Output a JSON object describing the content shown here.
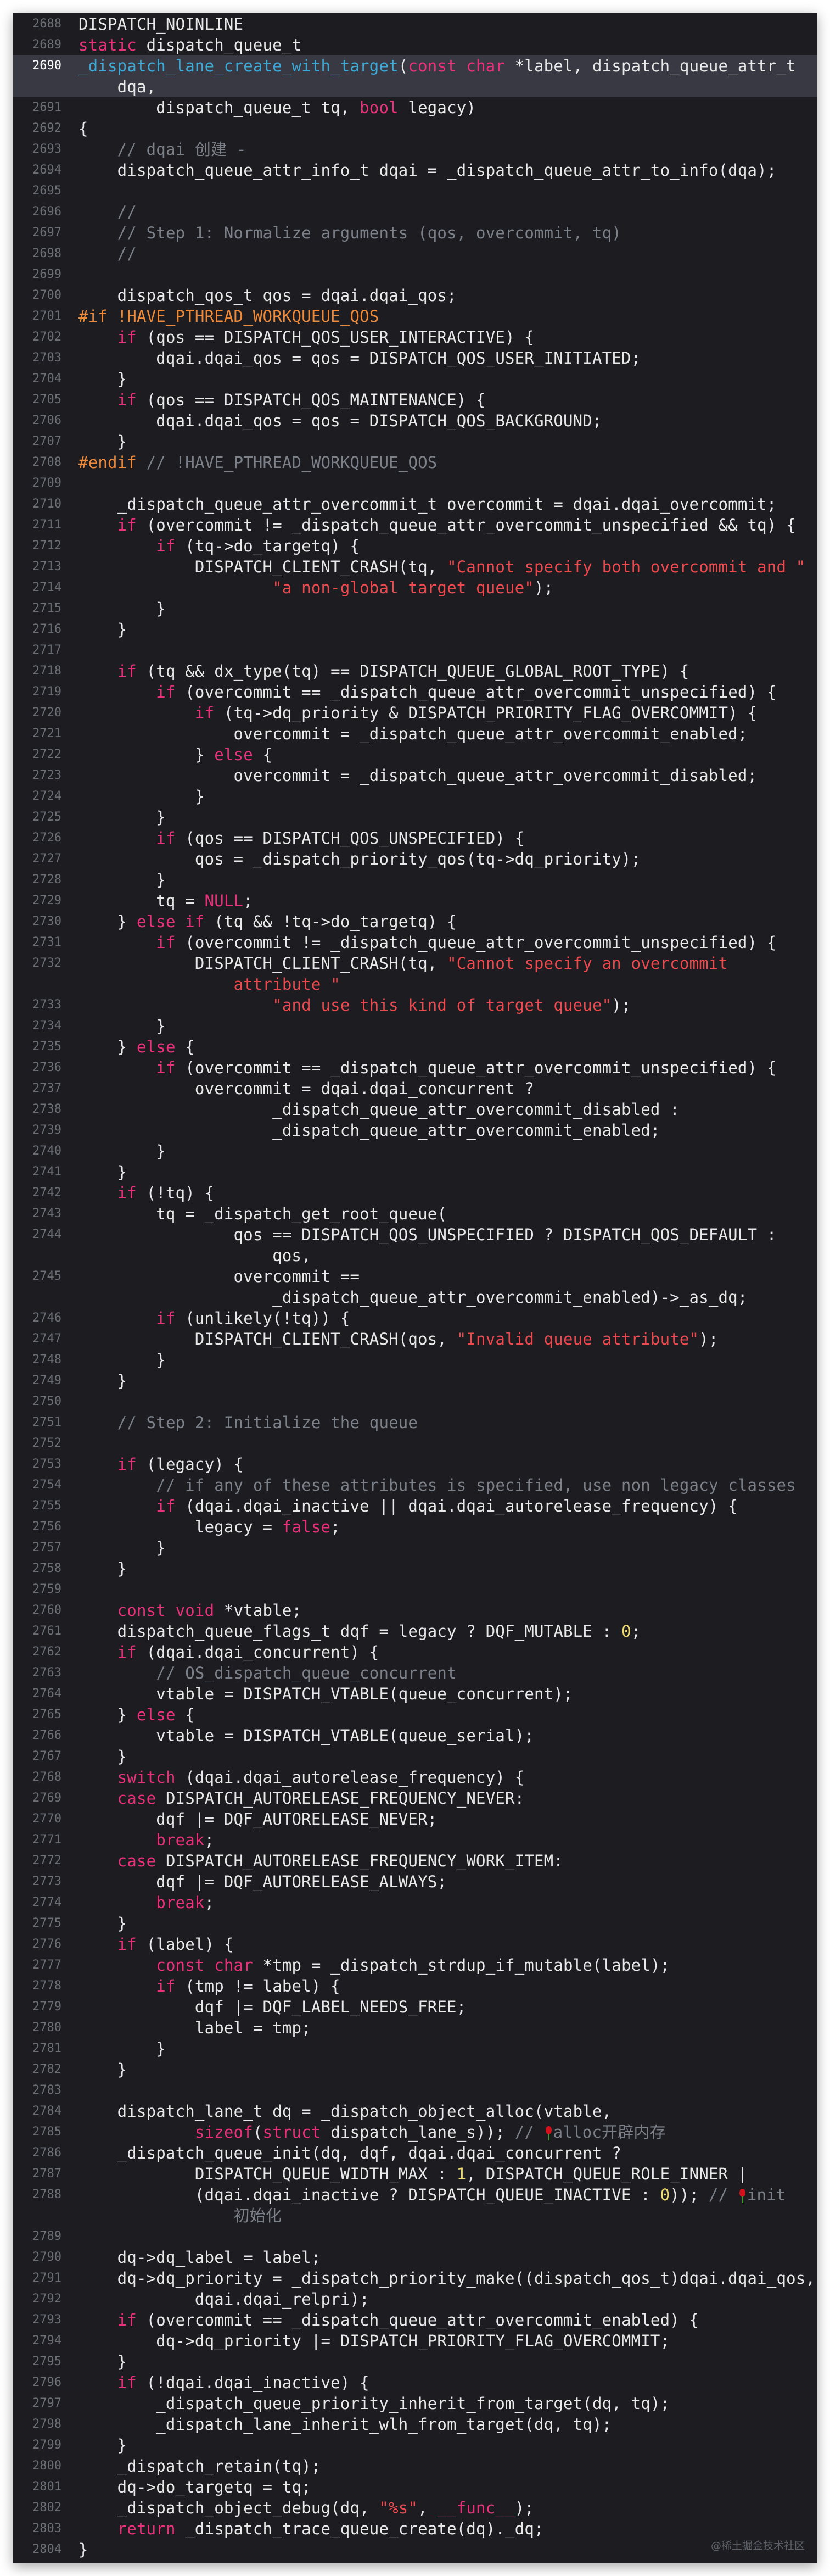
{
  "current_line": 2690,
  "watermark": "@稀土掘金技术社区",
  "colors": {
    "background": "#1c1c21",
    "highlight": "#393944",
    "keyword": "#e8317a",
    "function": "#3fa9d6",
    "string": "#ec4a4f",
    "preprocessor": "#ee8a39",
    "comment": "#7c8089",
    "number": "#eedd6e"
  },
  "lines": [
    {
      "n": 2688,
      "rows": [
        "DISPATCH_NOINLINE"
      ]
    },
    {
      "n": 2689,
      "rows": [
        "⟦k:static⟧ dispatch_queue_t"
      ]
    },
    {
      "n": 2690,
      "rows": [
        "⟦f:_dispatch_lane_create_with_target⟧(⟦k:const char⟧ *label, dispatch_queue_attr_t",
        "    dqa,"
      ]
    },
    {
      "n": 2691,
      "rows": [
        "        dispatch_queue_t tq, ⟦k:bool⟧ legacy)"
      ]
    },
    {
      "n": 2692,
      "rows": [
        "{"
      ]
    },
    {
      "n": 2693,
      "rows": [
        "    ⟦c:// dqai 创建 -⟧"
      ]
    },
    {
      "n": 2694,
      "rows": [
        "    dispatch_queue_attr_info_t dqai = _dispatch_queue_attr_to_info(dqa);"
      ]
    },
    {
      "n": 2695,
      "rows": [
        ""
      ]
    },
    {
      "n": 2696,
      "rows": [
        "    ⟦c://⟧"
      ]
    },
    {
      "n": 2697,
      "rows": [
        "    ⟦c:// Step 1: Normalize arguments (qos, overcommit, tq)⟧"
      ]
    },
    {
      "n": 2698,
      "rows": [
        "    ⟦c://⟧"
      ]
    },
    {
      "n": 2699,
      "rows": [
        ""
      ]
    },
    {
      "n": 2700,
      "rows": [
        "    dispatch_qos_t qos = dqai.dqai_qos;"
      ]
    },
    {
      "n": 2701,
      "rows": [
        "⟦pp:#if !HAVE_PTHREAD_WORKQUEUE_QOS⟧"
      ]
    },
    {
      "n": 2702,
      "rows": [
        "    ⟦k:if⟧ (qos == DISPATCH_QOS_USER_INTERACTIVE) {"
      ]
    },
    {
      "n": 2703,
      "rows": [
        "        dqai.dqai_qos = qos = DISPATCH_QOS_USER_INITIATED;"
      ]
    },
    {
      "n": 2704,
      "rows": [
        "    }"
      ]
    },
    {
      "n": 2705,
      "rows": [
        "    ⟦k:if⟧ (qos == DISPATCH_QOS_MAINTENANCE) {"
      ]
    },
    {
      "n": 2706,
      "rows": [
        "        dqai.dqai_qos = qos = DISPATCH_QOS_BACKGROUND;"
      ]
    },
    {
      "n": 2707,
      "rows": [
        "    }"
      ]
    },
    {
      "n": 2708,
      "rows": [
        "⟦pp:#endif⟧ ⟦c:// !HAVE_PTHREAD_WORKQUEUE_QOS⟧"
      ]
    },
    {
      "n": 2709,
      "rows": [
        ""
      ]
    },
    {
      "n": 2710,
      "rows": [
        "    _dispatch_queue_attr_overcommit_t overcommit = dqai.dqai_overcommit;"
      ]
    },
    {
      "n": 2711,
      "rows": [
        "    ⟦k:if⟧ (overcommit != _dispatch_queue_attr_overcommit_unspecified && tq) {"
      ]
    },
    {
      "n": 2712,
      "rows": [
        "        ⟦k:if⟧ (tq->do_targetq) {"
      ]
    },
    {
      "n": 2713,
      "rows": [
        "            DISPATCH_CLIENT_CRASH(tq, ⟦s:\"Cannot specify both overcommit and \"⟧"
      ]
    },
    {
      "n": 2714,
      "rows": [
        "                    ⟦s:\"a non-global target queue\"⟧);"
      ]
    },
    {
      "n": 2715,
      "rows": [
        "        }"
      ]
    },
    {
      "n": 2716,
      "rows": [
        "    }"
      ]
    },
    {
      "n": 2717,
      "rows": [
        ""
      ]
    },
    {
      "n": 2718,
      "rows": [
        "    ⟦k:if⟧ (tq && dx_type(tq) == DISPATCH_QUEUE_GLOBAL_ROOT_TYPE) {"
      ]
    },
    {
      "n": 2719,
      "rows": [
        "        ⟦k:if⟧ (overcommit == _dispatch_queue_attr_overcommit_unspecified) {"
      ]
    },
    {
      "n": 2720,
      "rows": [
        "            ⟦k:if⟧ (tq->dq_priority & DISPATCH_PRIORITY_FLAG_OVERCOMMIT) {"
      ]
    },
    {
      "n": 2721,
      "rows": [
        "                overcommit = _dispatch_queue_attr_overcommit_enabled;"
      ]
    },
    {
      "n": 2722,
      "rows": [
        "            } ⟦k:else⟧ {"
      ]
    },
    {
      "n": 2723,
      "rows": [
        "                overcommit = _dispatch_queue_attr_overcommit_disabled;"
      ]
    },
    {
      "n": 2724,
      "rows": [
        "            }"
      ]
    },
    {
      "n": 2725,
      "rows": [
        "        }"
      ]
    },
    {
      "n": 2726,
      "rows": [
        "        ⟦k:if⟧ (qos == DISPATCH_QOS_UNSPECIFIED) {"
      ]
    },
    {
      "n": 2727,
      "rows": [
        "            qos = _dispatch_priority_qos(tq->dq_priority);"
      ]
    },
    {
      "n": 2728,
      "rows": [
        "        }"
      ]
    },
    {
      "n": 2729,
      "rows": [
        "        tq = ⟦k:NULL⟧;"
      ]
    },
    {
      "n": 2730,
      "rows": [
        "    } ⟦k:else if⟧ (tq && !tq->do_targetq) {"
      ]
    },
    {
      "n": 2731,
      "rows": [
        "        ⟦k:if⟧ (overcommit != _dispatch_queue_attr_overcommit_unspecified) {"
      ]
    },
    {
      "n": 2732,
      "rows": [
        "            DISPATCH_CLIENT_CRASH(tq, ⟦s:\"Cannot specify an overcommit⟧",
        "                ⟦s:attribute \"⟧"
      ]
    },
    {
      "n": 2733,
      "rows": [
        "                    ⟦s:\"and use this kind of target queue\"⟧);"
      ]
    },
    {
      "n": 2734,
      "rows": [
        "        }"
      ]
    },
    {
      "n": 2735,
      "rows": [
        "    } ⟦k:else⟧ {"
      ]
    },
    {
      "n": 2736,
      "rows": [
        "        ⟦k:if⟧ (overcommit == _dispatch_queue_attr_overcommit_unspecified) {"
      ]
    },
    {
      "n": 2737,
      "rows": [
        "            overcommit = dqai.dqai_concurrent ?"
      ]
    },
    {
      "n": 2738,
      "rows": [
        "                    _dispatch_queue_attr_overcommit_disabled :"
      ]
    },
    {
      "n": 2739,
      "rows": [
        "                    _dispatch_queue_attr_overcommit_enabled;"
      ]
    },
    {
      "n": 2740,
      "rows": [
        "        }"
      ]
    },
    {
      "n": 2741,
      "rows": [
        "    }"
      ]
    },
    {
      "n": 2742,
      "rows": [
        "    ⟦k:if⟧ (!tq) {"
      ]
    },
    {
      "n": 2743,
      "rows": [
        "        tq = _dispatch_get_root_queue("
      ]
    },
    {
      "n": 2744,
      "rows": [
        "                qos == DISPATCH_QOS_UNSPECIFIED ? DISPATCH_QOS_DEFAULT :",
        "                    qos,"
      ]
    },
    {
      "n": 2745,
      "rows": [
        "                overcommit ==",
        "                    _dispatch_queue_attr_overcommit_enabled)->_as_dq;"
      ]
    },
    {
      "n": 2746,
      "rows": [
        "        ⟦k:if⟧ (unlikely(!tq)) {"
      ]
    },
    {
      "n": 2747,
      "rows": [
        "            DISPATCH_CLIENT_CRASH(qos, ⟦s:\"Invalid queue attribute\"⟧);"
      ]
    },
    {
      "n": 2748,
      "rows": [
        "        }"
      ]
    },
    {
      "n": 2749,
      "rows": [
        "    }"
      ]
    },
    {
      "n": 2750,
      "rows": [
        ""
      ]
    },
    {
      "n": 2751,
      "rows": [
        "    ⟦c:// Step 2: Initialize the queue⟧"
      ]
    },
    {
      "n": 2752,
      "rows": [
        ""
      ]
    },
    {
      "n": 2753,
      "rows": [
        "    ⟦k:if⟧ (legacy) {"
      ]
    },
    {
      "n": 2754,
      "rows": [
        "        ⟦c:// if any of these attributes is specified, use non legacy classes⟧"
      ]
    },
    {
      "n": 2755,
      "rows": [
        "        ⟦k:if⟧ (dqai.dqai_inactive || dqai.dqai_autorelease_frequency) {"
      ]
    },
    {
      "n": 2756,
      "rows": [
        "            legacy = ⟦k:false⟧;"
      ]
    },
    {
      "n": 2757,
      "rows": [
        "        }"
      ]
    },
    {
      "n": 2758,
      "rows": [
        "    }"
      ]
    },
    {
      "n": 2759,
      "rows": [
        ""
      ]
    },
    {
      "n": 2760,
      "rows": [
        "    ⟦k:const void⟧ *vtable;"
      ]
    },
    {
      "n": 2761,
      "rows": [
        "    dispatch_queue_flags_t dqf = legacy ? DQF_MUTABLE : ⟦n:0⟧;"
      ]
    },
    {
      "n": 2762,
      "rows": [
        "    ⟦k:if⟧ (dqai.dqai_concurrent) {"
      ]
    },
    {
      "n": 2763,
      "rows": [
        "        ⟦c:// OS_dispatch_queue_concurrent⟧"
      ]
    },
    {
      "n": 2764,
      "rows": [
        "        vtable = DISPATCH_VTABLE(queue_concurrent);"
      ]
    },
    {
      "n": 2765,
      "rows": [
        "    } ⟦k:else⟧ {"
      ]
    },
    {
      "n": 2766,
      "rows": [
        "        vtable = DISPATCH_VTABLE(queue_serial);"
      ]
    },
    {
      "n": 2767,
      "rows": [
        "    }"
      ]
    },
    {
      "n": 2768,
      "rows": [
        "    ⟦k:switch⟧ (dqai.dqai_autorelease_frequency) {"
      ]
    },
    {
      "n": 2769,
      "rows": [
        "    ⟦k:case⟧ DISPATCH_AUTORELEASE_FREQUENCY_NEVER:"
      ]
    },
    {
      "n": 2770,
      "rows": [
        "        dqf |= DQF_AUTORELEASE_NEVER;"
      ]
    },
    {
      "n": 2771,
      "rows": [
        "        ⟦k:break⟧;"
      ]
    },
    {
      "n": 2772,
      "rows": [
        "    ⟦k:case⟧ DISPATCH_AUTORELEASE_FREQUENCY_WORK_ITEM:"
      ]
    },
    {
      "n": 2773,
      "rows": [
        "        dqf |= DQF_AUTORELEASE_ALWAYS;"
      ]
    },
    {
      "n": 2774,
      "rows": [
        "        ⟦k:break⟧;"
      ]
    },
    {
      "n": 2775,
      "rows": [
        "    }"
      ]
    },
    {
      "n": 2776,
      "rows": [
        "    ⟦k:if⟧ (label) {"
      ]
    },
    {
      "n": 2777,
      "rows": [
        "        ⟦k:const char⟧ *tmp = _dispatch_strdup_if_mutable(label);"
      ]
    },
    {
      "n": 2778,
      "rows": [
        "        ⟦k:if⟧ (tmp != label) {"
      ]
    },
    {
      "n": 2779,
      "rows": [
        "            dqf |= DQF_LABEL_NEEDS_FREE;"
      ]
    },
    {
      "n": 2780,
      "rows": [
        "            label = tmp;"
      ]
    },
    {
      "n": 2781,
      "rows": [
        "        }"
      ]
    },
    {
      "n": 2782,
      "rows": [
        "    }"
      ]
    },
    {
      "n": 2783,
      "rows": [
        ""
      ]
    },
    {
      "n": 2784,
      "rows": [
        "    dispatch_lane_t dq = _dispatch_object_alloc(vtable,"
      ]
    },
    {
      "n": 2785,
      "rows": [
        "            ⟦k:sizeof⟧(⟦k:struct⟧ dispatch_lane_s)); ⟦c:// ⟧⟦i:rose⟧⟦c:alloc开辟内存⟧"
      ]
    },
    {
      "n": 2786,
      "rows": [
        "    _dispatch_queue_init(dq, dqf, dqai.dqai_concurrent ?"
      ]
    },
    {
      "n": 2787,
      "rows": [
        "            DISPATCH_QUEUE_WIDTH_MAX : ⟦n:1⟧, DISPATCH_QUEUE_ROLE_INNER |"
      ]
    },
    {
      "n": 2788,
      "rows": [
        "            (dqai.dqai_inactive ? DISPATCH_QUEUE_INACTIVE : ⟦n:0⟧)); ⟦c:// ⟧⟦i:rose⟧⟦c:init⟧",
        "                ⟦c:初始化⟧"
      ]
    },
    {
      "n": 2789,
      "rows": [
        ""
      ]
    },
    {
      "n": 2790,
      "rows": [
        "    dq->dq_label = label;"
      ]
    },
    {
      "n": 2791,
      "rows": [
        "    dq->dq_priority = _dispatch_priority_make((dispatch_qos_t)dqai.dqai_qos,"
      ]
    },
    {
      "n": 2792,
      "rows": [
        "            dqai.dqai_relpri);"
      ]
    },
    {
      "n": 2793,
      "rows": [
        "    ⟦k:if⟧ (overcommit == _dispatch_queue_attr_overcommit_enabled) {"
      ]
    },
    {
      "n": 2794,
      "rows": [
        "        dq->dq_priority |= DISPATCH_PRIORITY_FLAG_OVERCOMMIT;"
      ]
    },
    {
      "n": 2795,
      "rows": [
        "    }"
      ]
    },
    {
      "n": 2796,
      "rows": [
        "    ⟦k:if⟧ (!dqai.dqai_inactive) {"
      ]
    },
    {
      "n": 2797,
      "rows": [
        "        _dispatch_queue_priority_inherit_from_target(dq, tq);"
      ]
    },
    {
      "n": 2798,
      "rows": [
        "        _dispatch_lane_inherit_wlh_from_target(dq, tq);"
      ]
    },
    {
      "n": 2799,
      "rows": [
        "    }"
      ]
    },
    {
      "n": 2800,
      "rows": [
        "    _dispatch_retain(tq);"
      ]
    },
    {
      "n": 2801,
      "rows": [
        "    dq->do_targetq = tq;"
      ]
    },
    {
      "n": 2802,
      "rows": [
        "    _dispatch_object_debug(dq, ⟦s:\"%s\"⟧, ⟦k:__func__⟧);"
      ]
    },
    {
      "n": 2803,
      "rows": [
        "    ⟦k:return⟧ _dispatch_trace_queue_create(dq)._dq;"
      ]
    },
    {
      "n": 2804,
      "rows": [
        "}"
      ]
    }
  ]
}
